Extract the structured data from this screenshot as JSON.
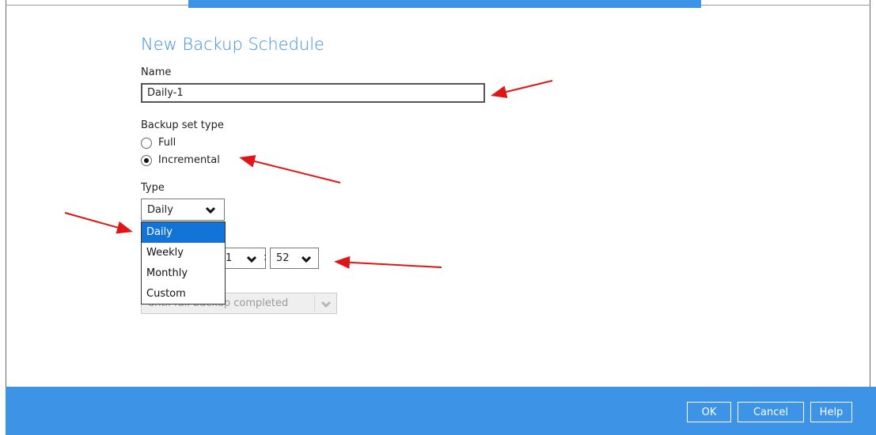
{
  "dialog": {
    "title": "New Backup Schedule"
  },
  "name_field": {
    "label": "Name",
    "value": "Daily-1"
  },
  "backup_set_type": {
    "label": "Backup set type",
    "options": [
      "Full",
      "Incremental"
    ],
    "selected": "Incremental"
  },
  "type_field": {
    "label": "Type",
    "value": "Daily",
    "options": [
      "Daily",
      "Weekly",
      "Monthly",
      "Custom"
    ],
    "highlighted": "Daily"
  },
  "time": {
    "hour_partial": "1",
    "separator": ":",
    "minute": "52"
  },
  "stop_field": {
    "value": "until full backup completed"
  },
  "footer": {
    "ok": "OK",
    "cancel": "Cancel",
    "help": "Help"
  },
  "colors": {
    "accent": "#3d93e6",
    "title": "#3e8fe0",
    "selection": "#1174d6",
    "annotation_arrow": "#e01515"
  }
}
